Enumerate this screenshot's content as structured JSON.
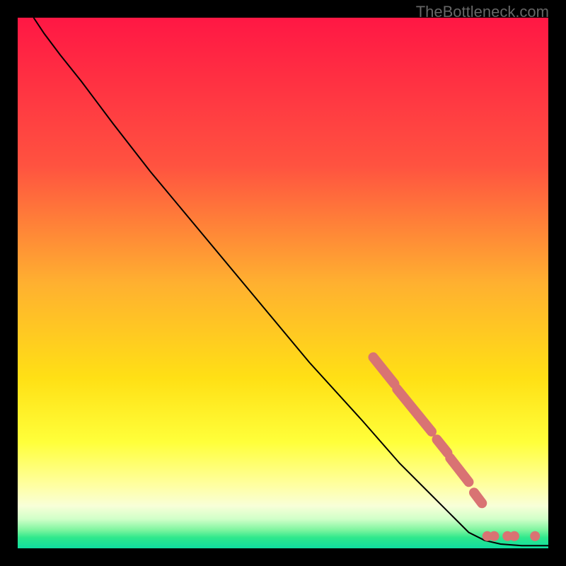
{
  "watermark": "TheBottleneck.com",
  "chart_data": {
    "type": "line",
    "title": "",
    "xlabel": "",
    "ylabel": "",
    "xlim": [
      0,
      100
    ],
    "ylim": [
      0,
      100
    ],
    "curve": [
      {
        "x": 3,
        "y": 100
      },
      {
        "x": 5,
        "y": 97
      },
      {
        "x": 8,
        "y": 93
      },
      {
        "x": 12,
        "y": 88
      },
      {
        "x": 18,
        "y": 80
      },
      {
        "x": 25,
        "y": 71
      },
      {
        "x": 35,
        "y": 59
      },
      {
        "x": 45,
        "y": 47
      },
      {
        "x": 55,
        "y": 35
      },
      {
        "x": 65,
        "y": 24
      },
      {
        "x": 72,
        "y": 16
      },
      {
        "x": 78,
        "y": 10
      },
      {
        "x": 82,
        "y": 6
      },
      {
        "x": 85,
        "y": 3
      },
      {
        "x": 88,
        "y": 1.5
      },
      {
        "x": 91,
        "y": 0.8
      },
      {
        "x": 95,
        "y": 0.5
      },
      {
        "x": 100,
        "y": 0.5
      }
    ],
    "highlight_segments": [
      {
        "x1": 67,
        "y1": 36,
        "x2": 71,
        "y2": 31
      },
      {
        "x1": 71.5,
        "y1": 30,
        "x2": 78,
        "y2": 22
      },
      {
        "x1": 79,
        "y1": 20.5,
        "x2": 81,
        "y2": 18
      },
      {
        "x1": 81.5,
        "y1": 17,
        "x2": 85,
        "y2": 12.5
      },
      {
        "x1": 86,
        "y1": 10.5,
        "x2": 87.5,
        "y2": 8.5
      }
    ],
    "highlight_dots": [
      {
        "x": 88.5,
        "y": 2.3
      },
      {
        "x": 89.8,
        "y": 2.3
      },
      {
        "x": 92.3,
        "y": 2.3
      },
      {
        "x": 93.6,
        "y": 2.3
      },
      {
        "x": 97.5,
        "y": 2.3
      }
    ],
    "gradient_stops": [
      {
        "offset": 0,
        "color": "#ff1744"
      },
      {
        "offset": 28,
        "color": "#ff5340"
      },
      {
        "offset": 50,
        "color": "#ffb030"
      },
      {
        "offset": 68,
        "color": "#ffe015"
      },
      {
        "offset": 80,
        "color": "#ffff3a"
      },
      {
        "offset": 88,
        "color": "#ffffa0"
      },
      {
        "offset": 92,
        "color": "#f8ffd8"
      },
      {
        "offset": 94.5,
        "color": "#d0ffc8"
      },
      {
        "offset": 96.5,
        "color": "#80f5a0"
      },
      {
        "offset": 98,
        "color": "#2ee88c"
      },
      {
        "offset": 100,
        "color": "#10dda0"
      }
    ],
    "highlight_color": "#d97373",
    "curve_color": "#000000"
  }
}
